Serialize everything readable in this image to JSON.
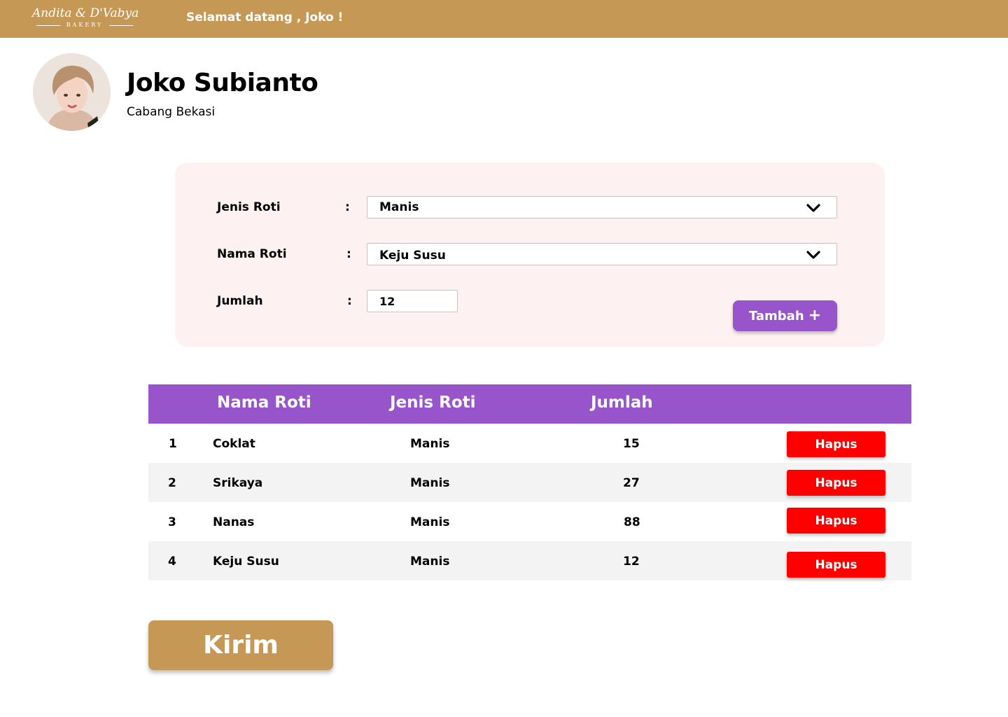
{
  "header": {
    "logo_main": "Andita & D'Vabya",
    "logo_sub": "BAKERY",
    "welcome": "Selamat datang , Joko !",
    "bg_color": "#C69855"
  },
  "profile": {
    "name": "Joko Subianto",
    "branch": "Cabang Bekasi"
  },
  "form": {
    "bread_type_label": "Jenis Roti",
    "bread_type_value": "Manis",
    "bread_name_label": "Nama Roti",
    "bread_name_value": "Keju Susu",
    "quantity_label": "Jumlah",
    "quantity_value": "12",
    "colon": ":",
    "add_label": "Tambah",
    "add_icon": "+",
    "card_color": "#FDF2F1",
    "accent": "#9754CB"
  },
  "table": {
    "columns": [
      "Nama Roti",
      "Jenis Roti",
      "Jumlah"
    ],
    "header_color": "#9754CB",
    "delete_color": "#FF0000",
    "rows": [
      {
        "no": "1",
        "name": "Coklat",
        "type": "Manis",
        "qty": "15",
        "action": "Hapus"
      },
      {
        "no": "2",
        "name": "Srikaya",
        "type": "Manis",
        "qty": "27",
        "action": "Hapus"
      },
      {
        "no": "3",
        "name": "Nanas",
        "type": "Manis",
        "qty": "88",
        "action": "Hapus"
      },
      {
        "no": "4",
        "name": "Keju Susu",
        "type": "Manis",
        "qty": "12",
        "action": "Hapus"
      }
    ]
  },
  "submit": {
    "label": "Kirim"
  }
}
